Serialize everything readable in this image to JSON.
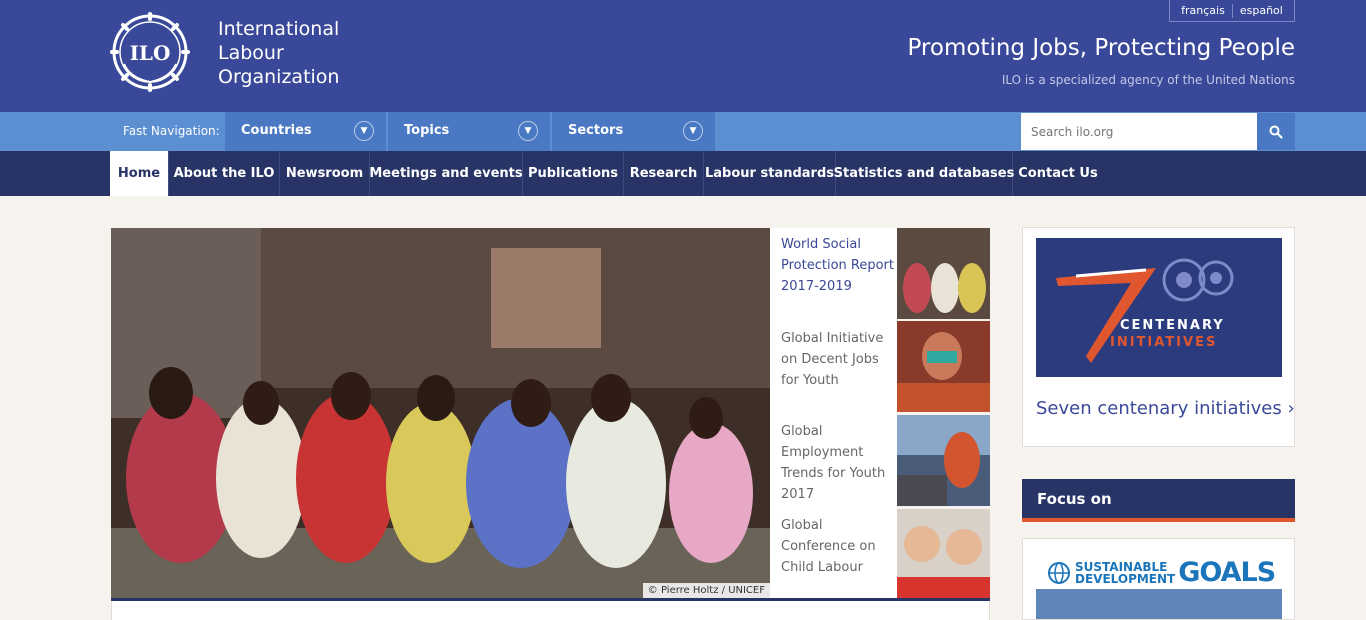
{
  "header": {
    "logo_lines": [
      "International",
      "Labour",
      "Organization"
    ],
    "logo_emblem_text": "ILO",
    "languages": [
      "français",
      "español"
    ],
    "tagline": "Promoting Jobs, Protecting People",
    "subtagline": "ILO is a specialized agency of the United Nations",
    "bg_color": "#3a4899"
  },
  "fast_nav": {
    "label": "Fast Navigation:",
    "items": [
      {
        "label": "Countries",
        "icon": "chevron-down-icon"
      },
      {
        "label": "Topics",
        "icon": "chevron-down-icon"
      },
      {
        "label": "Sectors",
        "icon": "chevron-down-icon"
      }
    ],
    "search_placeholder": "Search ilo.org",
    "search_icon": "search-icon"
  },
  "main_nav": {
    "items": [
      "Home",
      "About the ILO",
      "Newsroom",
      "Meetings and events",
      "Publications",
      "Research",
      "Labour standards",
      "Statistics and databases",
      "Contact Us"
    ],
    "active_index": 0
  },
  "hero": {
    "credit": "© Pierre Holtz / UNICEF",
    "stories": [
      {
        "title": "World Social Protection Report 2017-2019",
        "active": true
      },
      {
        "title": "Global Initiative on Decent Jobs for Youth",
        "active": false
      },
      {
        "title": "Global Employment Trends for Youth 2017",
        "active": false
      },
      {
        "title": "Global Conference on Child Labour",
        "active": false
      }
    ]
  },
  "sidebar": {
    "centenary_line1": "CENTENARY",
    "centenary_line2": "INITIATIVES",
    "centenary_link": "Seven centenary initiatives",
    "focus_title": "Focus on",
    "sdg_small_1": "SUSTAINABLE",
    "sdg_small_2": "DEVELOPMENT",
    "sdg_goals": "GOALS",
    "accent_color": "#e0572f"
  }
}
